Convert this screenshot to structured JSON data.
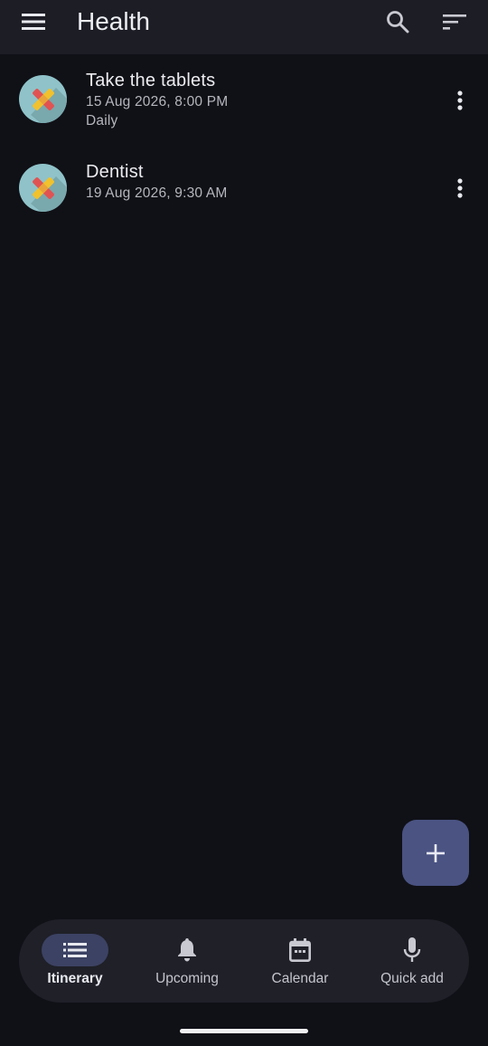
{
  "appbar": {
    "title": "Health",
    "icons": {
      "menu": "menu-icon",
      "search": "search-icon",
      "sort": "sort-icon"
    }
  },
  "items": [
    {
      "title": "Take the tablets",
      "datetime": "15 Aug 2026, 8:00 PM",
      "repeat": "Daily",
      "icon": "health-plaster-icon"
    },
    {
      "title": "Dentist",
      "datetime": "19 Aug 2026, 9:30 AM",
      "icon": "health-plaster-icon"
    }
  ],
  "fab": {
    "icon": "plus-icon"
  },
  "bottom_nav": [
    {
      "label": "Itinerary",
      "icon": "list-icon",
      "active": true
    },
    {
      "label": "Upcoming",
      "icon": "bell-icon",
      "active": false
    },
    {
      "label": "Calendar",
      "icon": "calendar-icon",
      "active": false
    },
    {
      "label": "Quick add",
      "icon": "mic-icon",
      "active": false
    }
  ],
  "colors": {
    "background": "#101117",
    "appbar": "#1c1d25",
    "fab": "#4a5382",
    "nav_active_pill": "#3c4263",
    "avatar_bg": "#8fc3c9",
    "plaster_red": "#e05353",
    "plaster_yellow": "#f1c12e"
  }
}
